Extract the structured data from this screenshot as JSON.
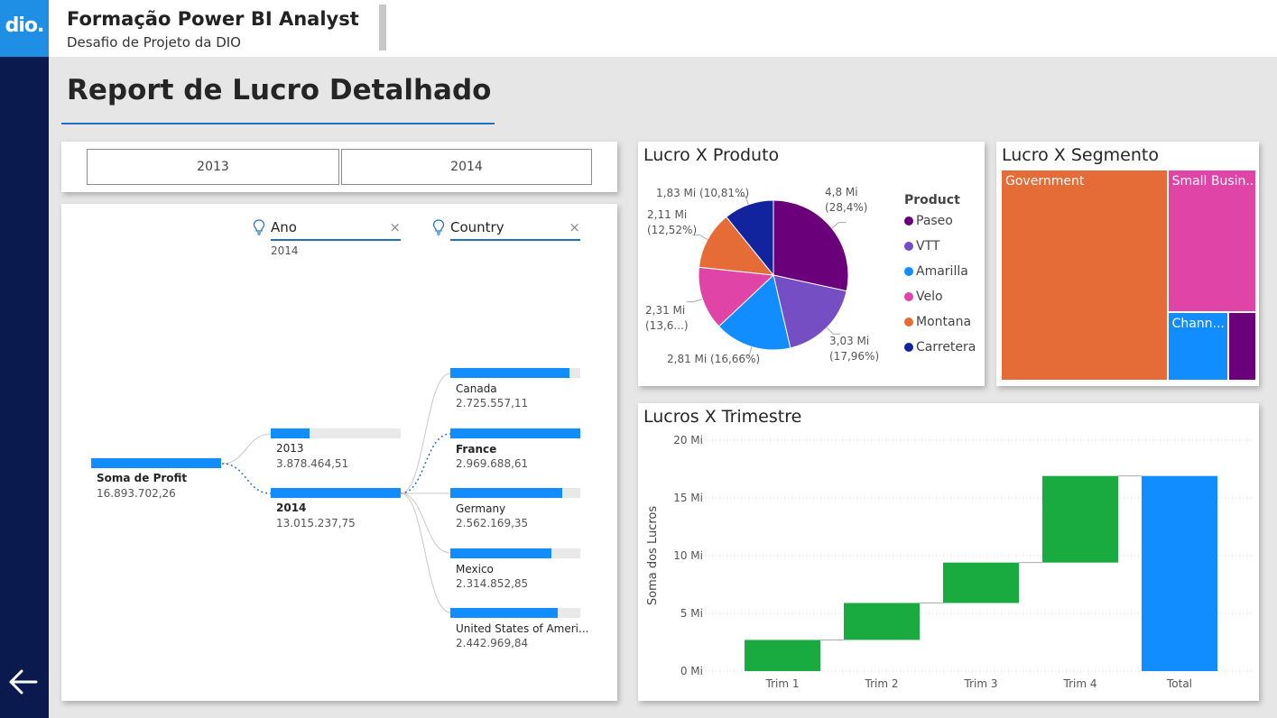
{
  "header": {
    "logo_text": "dio.",
    "title": "Formação Power BI Analyst",
    "subtitle": "Desafio de Projeto da DIO"
  },
  "report_title": "Report de Lucro Detalhado",
  "slicer": {
    "options": [
      "2013",
      "2014"
    ]
  },
  "decomposition_tree": {
    "filters": [
      {
        "name": "Ano",
        "close": "×",
        "value": "2014"
      },
      {
        "name": "Country",
        "close": "×",
        "value": ""
      }
    ],
    "root": {
      "label": "Soma de Profit",
      "value": "16.893.702,26"
    },
    "years": [
      {
        "label": "2013",
        "value": "3.878.464,51",
        "fraction": 0.298
      },
      {
        "label": "2014",
        "value": "13.015.237,75",
        "fraction": 1.0
      }
    ],
    "countries": [
      {
        "label": "Canada",
        "value": "2.725.557,11",
        "fraction": 0.918
      },
      {
        "label": "France",
        "value": "2.969.688,61",
        "fraction": 1.0
      },
      {
        "label": "Germany",
        "value": "2.562.169,35",
        "fraction": 0.863
      },
      {
        "label": "Mexico",
        "value": "2.314.852,85",
        "fraction": 0.78
      },
      {
        "label": "United States of Ameri...",
        "value": "2.442.969,84",
        "fraction": 0.823
      }
    ]
  },
  "colors": {
    "accent": "#118dff",
    "paseo": "#6b007b",
    "vtt": "#744ec2",
    "amarilla": "#118dff",
    "velo": "#e044a7",
    "montana": "#e66c37",
    "carretera": "#12239e",
    "waterfall_up": "#1aab40",
    "waterfall_total": "#118dff"
  },
  "chart_data": [
    {
      "type": "pie",
      "title": "Lucro X Produto",
      "legend_title": "Product",
      "legend_placement": "right",
      "slices": [
        {
          "name": "Paseo",
          "value": 4.8,
          "percent": 28.4,
          "label": "4,8 Mi\n(28,4%)",
          "color": "#6b007b"
        },
        {
          "name": "VTT",
          "value": 3.03,
          "percent": 17.96,
          "label": "3,03 Mi\n(17,96%)",
          "color": "#744ec2"
        },
        {
          "name": "Amarilla",
          "value": 2.81,
          "percent": 16.66,
          "label": "2,81 Mi (16,66%)",
          "color": "#118dff"
        },
        {
          "name": "Velo",
          "value": 2.31,
          "percent": 13.66,
          "label": "2,31 Mi\n(13,6...)",
          "color": "#e044a7"
        },
        {
          "name": "Montana",
          "value": 2.11,
          "percent": 12.52,
          "label": "2,11 Mi\n(12,52%)",
          "color": "#e66c37"
        },
        {
          "name": "Carretera",
          "value": 1.83,
          "percent": 10.81,
          "label": "1,83 Mi (10,81%)",
          "color": "#12239e"
        }
      ]
    },
    {
      "type": "treemap",
      "title": "Lucro X Segmento",
      "items": [
        {
          "name": "Government",
          "value": 11.39,
          "color": "#e66c37"
        },
        {
          "name": "Small Busin...",
          "value": 4.14,
          "color": "#e044a7"
        },
        {
          "name": "Chann...",
          "value": 1.35,
          "color": "#118dff"
        },
        {
          "name": "",
          "value": 0.65,
          "color": "#6b007b"
        }
      ]
    },
    {
      "type": "waterfall",
      "title": "Lucros X Trimestre",
      "categories": [
        "Trim 1",
        "Trim 2",
        "Trim 3",
        "Trim 4",
        "Total"
      ],
      "increments": [
        2.7,
        3.2,
        3.5,
        7.5
      ],
      "total": 16.9,
      "ylabel": "Soma dos Lucros",
      "ylim": [
        0,
        20
      ],
      "yticks": [
        "0 Mi",
        "5 Mi",
        "10 Mi",
        "15 Mi",
        "20 Mi"
      ],
      "ytick_values": [
        0,
        5,
        10,
        15,
        20
      ],
      "grid": true
    }
  ]
}
